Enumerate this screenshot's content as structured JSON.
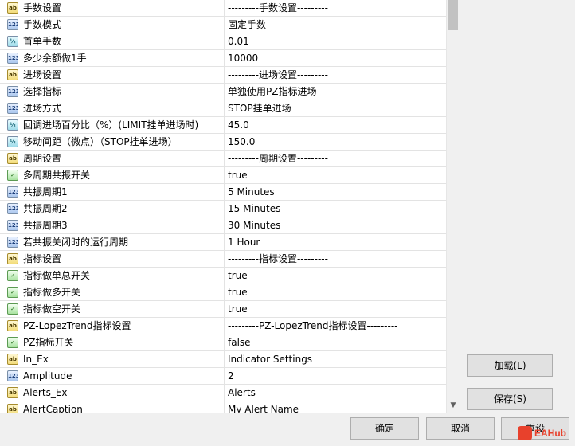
{
  "rows": [
    {
      "icon": "ab",
      "name": "手数设置",
      "value": "---------手数设置---------"
    },
    {
      "icon": "123",
      "name": "手数模式",
      "value": "固定手数"
    },
    {
      "icon": "half",
      "name": "首单手数",
      "value": "0.01"
    },
    {
      "icon": "123",
      "name": "多少余额做1手",
      "value": "10000"
    },
    {
      "icon": "ab",
      "name": "进场设置",
      "value": "---------进场设置---------"
    },
    {
      "icon": "123",
      "name": "选择指标",
      "value": "单独使用PZ指标进场"
    },
    {
      "icon": "123",
      "name": "进场方式",
      "value": "STOP挂单进场"
    },
    {
      "icon": "half",
      "name": "回调进场百分比（%）(LIMIT挂单进场时)",
      "value": "45.0"
    },
    {
      "icon": "half",
      "name": "移动间距（微点）（STOP挂单进场）",
      "value": "150.0"
    },
    {
      "icon": "ab",
      "name": "周期设置",
      "value": "---------周期设置---------"
    },
    {
      "icon": "bool",
      "name": "多周期共振开关",
      "value": "true"
    },
    {
      "icon": "123",
      "name": "共振周期1",
      "value": "5 Minutes"
    },
    {
      "icon": "123",
      "name": "共振周期2",
      "value": "15 Minutes"
    },
    {
      "icon": "123",
      "name": "共振周期3",
      "value": "30 Minutes"
    },
    {
      "icon": "123",
      "name": "若共振关闭时的运行周期",
      "value": "1 Hour"
    },
    {
      "icon": "ab",
      "name": "指标设置",
      "value": "---------指标设置---------"
    },
    {
      "icon": "bool",
      "name": "指标做单总开关",
      "value": "true"
    },
    {
      "icon": "bool",
      "name": "指标做多开关",
      "value": "true"
    },
    {
      "icon": "bool",
      "name": "指标做空开关",
      "value": "true"
    },
    {
      "icon": "ab",
      "name": "PZ-LopezTrend指标设置",
      "value": "---------PZ-LopezTrend指标设置---------"
    },
    {
      "icon": "bool",
      "name": "PZ指标开关",
      "value": "false"
    },
    {
      "icon": "ab",
      "name": "In_Ex",
      "value": "Indicator Settings"
    },
    {
      "icon": "123",
      "name": "Amplitude",
      "value": "2"
    },
    {
      "icon": "ab",
      "name": "Alerts_Ex",
      "value": "Alerts"
    },
    {
      "icon": "ab",
      "name": "AlertCaption",
      "value": "My Alert Name"
    }
  ],
  "icons": {
    "ab": {
      "glyph": "ab",
      "name": "string-type-icon"
    },
    "123": {
      "glyph": "123",
      "name": "integer-type-icon"
    },
    "half": {
      "glyph": "½",
      "name": "double-type-icon"
    },
    "bool": {
      "glyph": "✓",
      "name": "bool-type-icon"
    }
  },
  "buttons": {
    "load": "加载(L)",
    "save": "保存(S)",
    "ok": "确定",
    "cancel": "取消",
    "reset": "重设"
  },
  "watermark": "EAHub"
}
